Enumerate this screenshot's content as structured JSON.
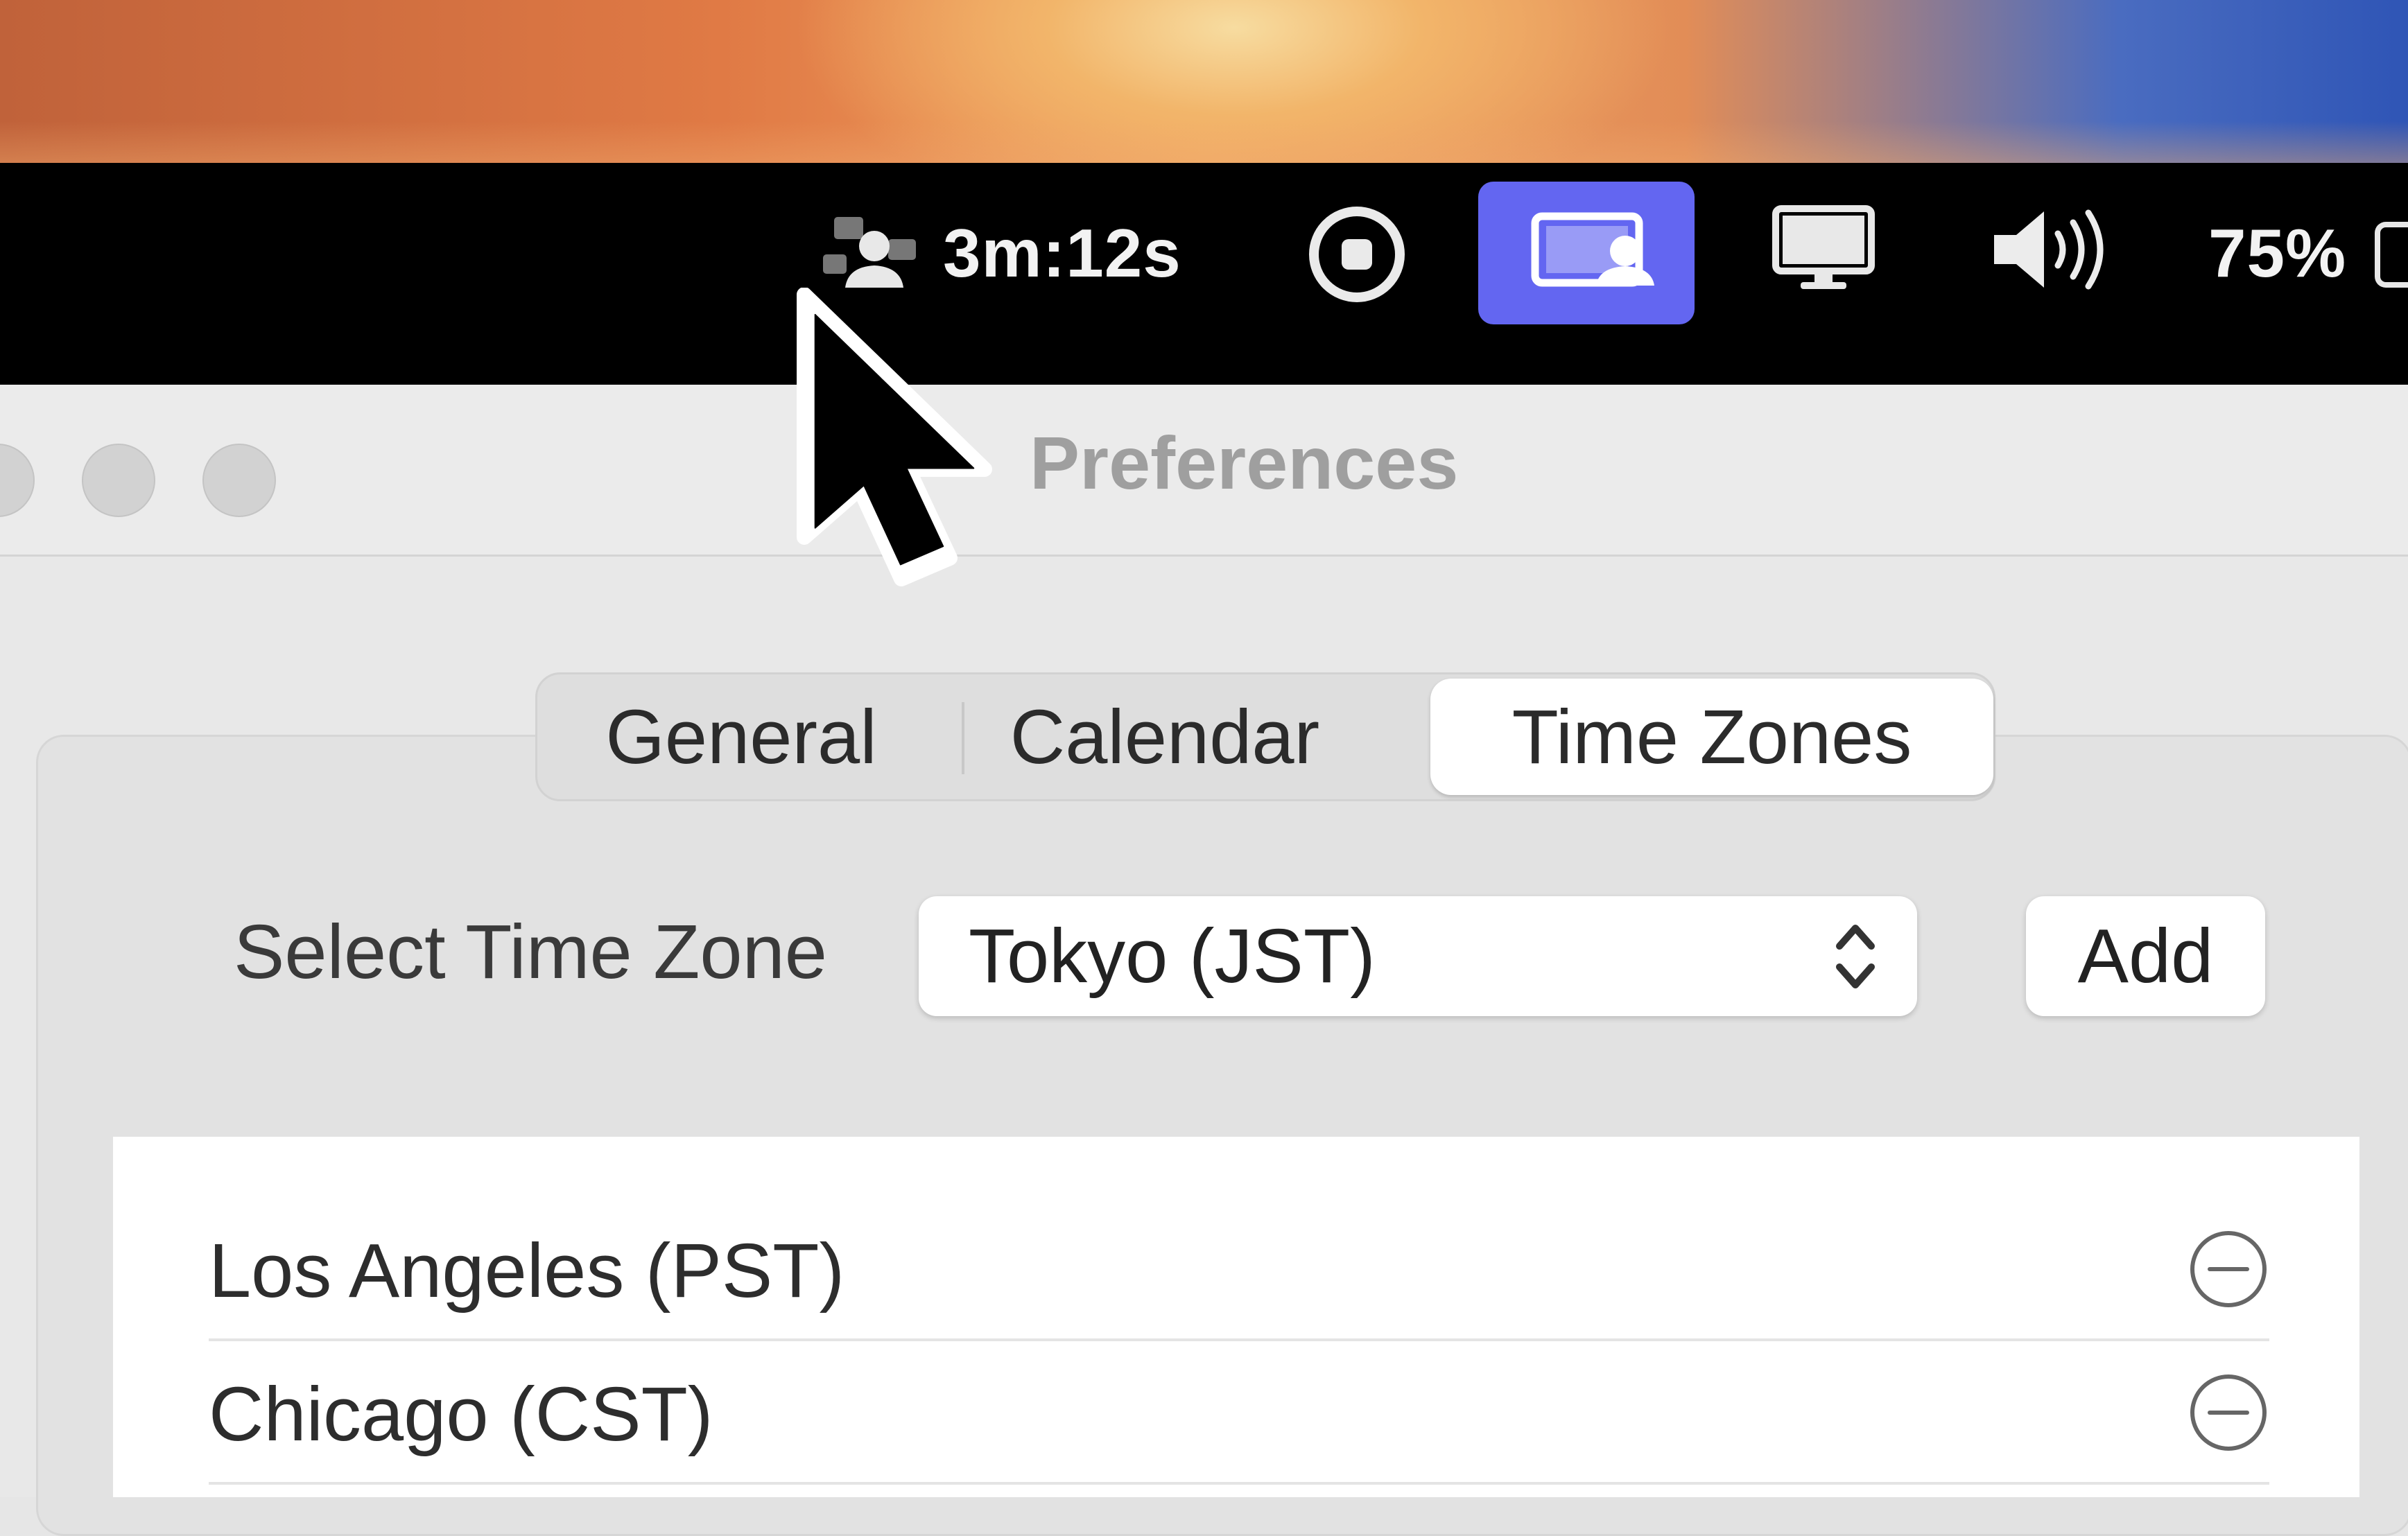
{
  "menubar": {
    "timer": "3m:12s",
    "battery": "75%",
    "icons": [
      "screen-share-participants-icon",
      "stop-recording-icon",
      "screen-share-icon",
      "display-icon",
      "volume-icon",
      "battery-icon"
    ],
    "accent_color": "#6366f1"
  },
  "window": {
    "title": "Preferences"
  },
  "tabs": [
    {
      "label": "General",
      "active": false
    },
    {
      "label": "Calendar",
      "active": false
    },
    {
      "label": "Time Zones",
      "active": true
    }
  ],
  "timezone_picker": {
    "label": "Select Time Zone",
    "selected": "Tokyo (JST)",
    "add_label": "Add"
  },
  "timezones": [
    {
      "label": "Los Angeles (PST)"
    },
    {
      "label": "Chicago (CST)"
    }
  ]
}
